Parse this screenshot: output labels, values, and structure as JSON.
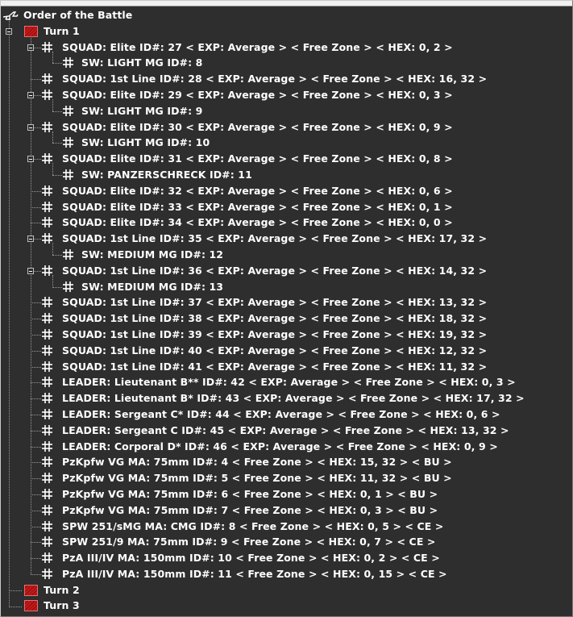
{
  "tree": {
    "root_label": "Order of the Battle",
    "turns": [
      {
        "label": "Turn 1",
        "expanded": true,
        "units": [
          {
            "label": "SQUAD: Elite   ID#: 27 < EXP: Average >  < Free Zone >  < HEX: 0, 2 >",
            "children": [
              "SW: LIGHT MG  ID#: 8"
            ]
          },
          {
            "label": "SQUAD: 1st Line   ID#: 28 < EXP: Average >  < Free Zone >  < HEX: 16, 32 >",
            "children": []
          },
          {
            "label": "SQUAD: Elite   ID#: 29 < EXP: Average >  < Free Zone >  < HEX: 0, 3 >",
            "children": [
              "SW: LIGHT MG  ID#: 9"
            ]
          },
          {
            "label": "SQUAD: Elite   ID#: 30 < EXP: Average >  < Free Zone >  < HEX: 0, 9 >",
            "children": [
              "SW: LIGHT MG  ID#: 10"
            ]
          },
          {
            "label": "SQUAD: Elite   ID#: 31 < EXP: Average >  < Free Zone >  < HEX: 0, 8 >",
            "children": [
              "SW: PANZERSCHRECK  ID#: 11"
            ]
          },
          {
            "label": "SQUAD: Elite   ID#: 32 < EXP: Average >  < Free Zone >  < HEX: 0, 6 >",
            "children": []
          },
          {
            "label": "SQUAD: Elite   ID#: 33 < EXP: Average >  < Free Zone >  < HEX: 0, 1 >",
            "children": []
          },
          {
            "label": "SQUAD: Elite   ID#: 34 < EXP: Average >  < Free Zone >  < HEX: 0, 0 >",
            "children": []
          },
          {
            "label": "SQUAD: 1st Line   ID#: 35 < EXP: Average >  < Free Zone >  < HEX: 17, 32 >",
            "children": [
              "SW: MEDIUM MG  ID#: 12"
            ]
          },
          {
            "label": "SQUAD: 1st Line   ID#: 36 < EXP: Average >  < Free Zone >  < HEX: 14, 32 >",
            "children": [
              "SW: MEDIUM MG  ID#: 13"
            ]
          },
          {
            "label": "SQUAD: 1st Line   ID#: 37 < EXP: Average >  < Free Zone >  < HEX: 13, 32 >",
            "children": []
          },
          {
            "label": "SQUAD: 1st Line   ID#: 38 < EXP: Average >  < Free Zone >  < HEX: 18, 32 >",
            "children": []
          },
          {
            "label": "SQUAD: 1st Line   ID#: 39 < EXP: Average >  < Free Zone >  < HEX: 19, 32 >",
            "children": []
          },
          {
            "label": "SQUAD: 1st Line   ID#: 40 < EXP: Average >  < Free Zone >  < HEX: 12, 32 >",
            "children": []
          },
          {
            "label": "SQUAD: 1st Line   ID#: 41 < EXP: Average >  < Free Zone >  < HEX: 11, 32 >",
            "children": []
          },
          {
            "label": "LEADER: Lieutenant B**   ID#: 42 < EXP: Average >  < Free Zone >  < HEX: 0, 3 >",
            "children": []
          },
          {
            "label": "LEADER: Lieutenant B*   ID#: 43 < EXP: Average >  < Free Zone >  < HEX: 17, 32 >",
            "children": []
          },
          {
            "label": "LEADER: Sergeant C*   ID#: 44 < EXP: Average >  < Free Zone >  < HEX: 0, 6 >",
            "children": []
          },
          {
            "label": "LEADER: Sergeant C   ID#: 45 < EXP: Average >  < Free Zone >  < HEX: 13, 32 >",
            "children": []
          },
          {
            "label": "LEADER: Corporal D*   ID#: 46 < EXP: Average >  < Free Zone >  < HEX: 0, 9 >",
            "children": []
          },
          {
            "label": "PzKpfw VG   MA: 75mm      ID#: 4   < Free Zone >  < HEX: 15, 32 >  < BU >",
            "children": []
          },
          {
            "label": "PzKpfw VG   MA: 75mm      ID#: 5   < Free Zone >  < HEX: 11, 32 >  < BU >",
            "children": []
          },
          {
            "label": "PzKpfw VG   MA: 75mm      ID#: 6   < Free Zone >  < HEX: 0, 1 >  < BU >",
            "children": []
          },
          {
            "label": "PzKpfw VG   MA: 75mm      ID#: 7   < Free Zone >  < HEX: 0, 3 >  < BU >",
            "children": []
          },
          {
            "label": "SPW 251/sMG   MA: CMG      ID#: 8   < Free Zone >  < HEX: 0, 5 >  < CE >",
            "children": []
          },
          {
            "label": "SPW 251/9   MA: 75mm      ID#: 9   < Free Zone >  < HEX: 0, 7 >  < CE >",
            "children": []
          },
          {
            "label": "PzA III/IV   MA: 150mm      ID#: 10   < Free Zone >  < HEX: 0, 2 >  < CE >",
            "children": []
          },
          {
            "label": "PzA III/IV   MA: 150mm      ID#: 11   < Free Zone >  < HEX: 0, 15 >  < CE >",
            "children": []
          }
        ]
      },
      {
        "label": "Turn 2",
        "expanded": false,
        "units": []
      },
      {
        "label": "Turn 3",
        "expanded": false,
        "units": []
      }
    ]
  },
  "colors": {
    "background": "#2e2e2e",
    "text": "#ffffff",
    "turn_icon": "#c41a1a",
    "tree_lines": "#9a9a9a"
  },
  "icons": {
    "root": "aircraft-icon",
    "turn": "turn-flag-icon",
    "unit": "counter-grid-icon",
    "toggle": "collapse-minus-icon"
  }
}
